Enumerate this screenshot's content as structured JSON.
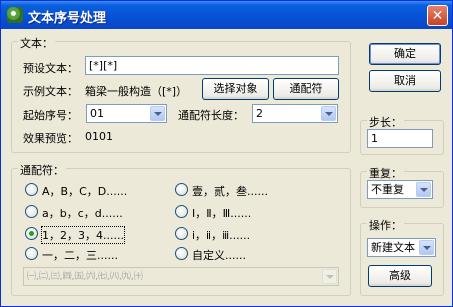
{
  "window": {
    "title": "文本序号处理",
    "close_glyph": "✕"
  },
  "text_group": {
    "legend": "文本：",
    "preset_label": "预设文本：",
    "preset_value": "[*][*]",
    "example_label": "示例文本：",
    "example_value": "箱梁一般构造（[*]）",
    "select_object_button": "选择对象",
    "wildcard_button": "通配符",
    "start_label": "起始序号：",
    "start_value": "01",
    "wildcard_length_label": "通配符长度：",
    "wildcard_length_value": "2",
    "preview_label": "效果预览：",
    "preview_value": "0101"
  },
  "wildcard_group": {
    "legend": "通配符：",
    "options": [
      {
        "label": "A，B，C，D......",
        "checked": false
      },
      {
        "label": "壹，贰，叁......",
        "checked": false
      },
      {
        "label": "a，b，c，d......",
        "checked": false
      },
      {
        "label": "Ⅰ，Ⅱ，Ⅲ......",
        "checked": false
      },
      {
        "label": "1，2，3，4......",
        "checked": true
      },
      {
        "label": "ⅰ，ⅱ，ⅲ......",
        "checked": false
      },
      {
        "label": "一，二，三......",
        "checked": false
      },
      {
        "label": "自定义......",
        "checked": false
      }
    ],
    "custom_value": "㈠,㈡,㈢,㈣,㈤,㈥,㈦,㈧,㈨,㈩"
  },
  "buttons": {
    "ok": "确定",
    "cancel": "取消",
    "advanced": "高级"
  },
  "step_group": {
    "legend": "步长：",
    "value": "1"
  },
  "repeat_group": {
    "legend": "重复：",
    "value": "不重复"
  },
  "operation_group": {
    "legend": "操作：",
    "value": "新建文本"
  }
}
